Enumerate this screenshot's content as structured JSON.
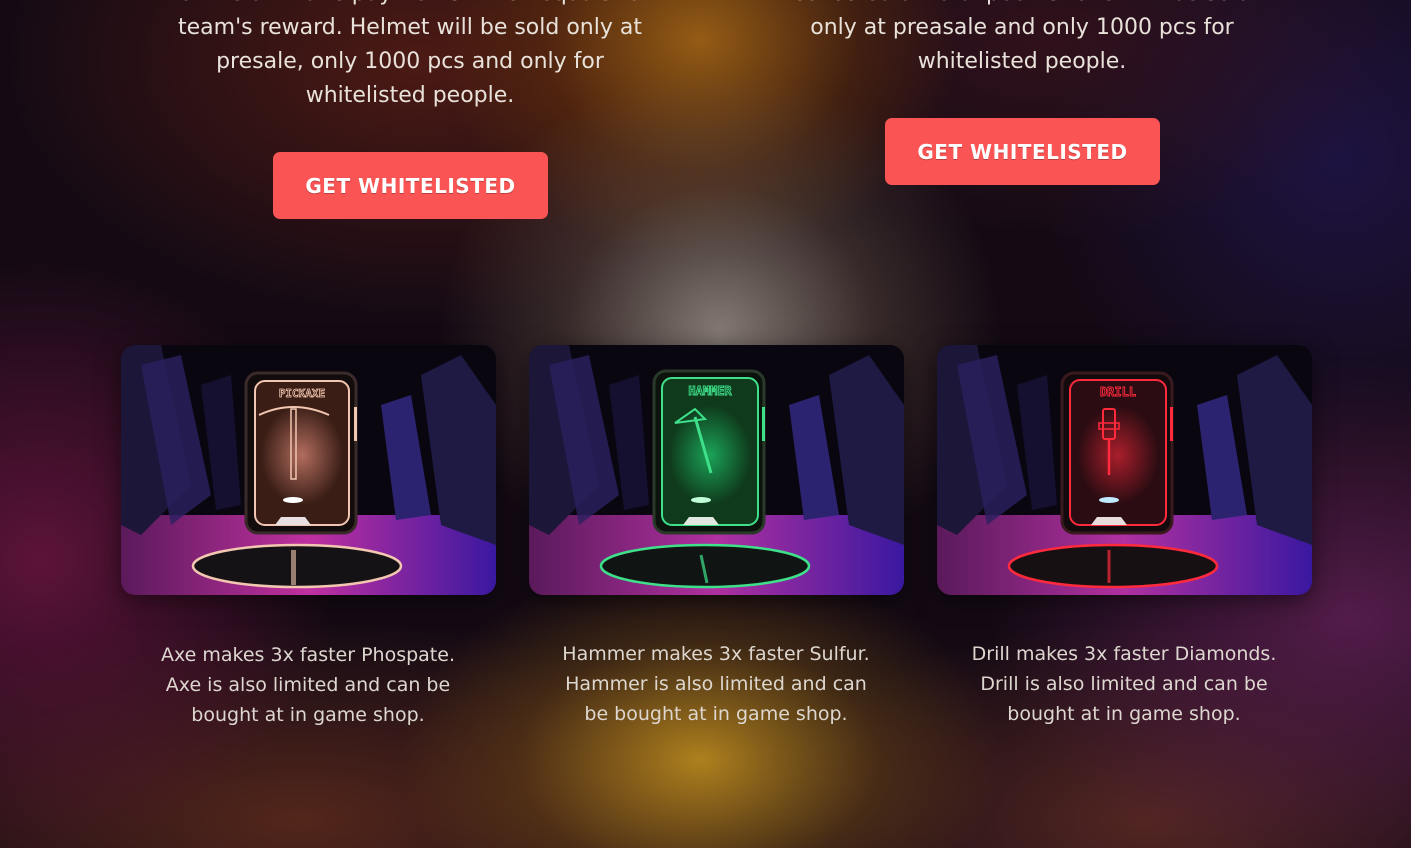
{
  "promo": {
    "left": {
      "text_lines": [
        "of the all matic payments which equals to",
        "team's reward. Helmet will be sold only at",
        "presale, only 1000 pcs and only for",
        "whitelisted people."
      ],
      "button_label": "GET WHITELISTED"
    },
    "right": {
      "text_lines": [
        "collected at total pool. Shovel will be sold",
        "only at preasale and only 1000 pcs for",
        "whitelisted people."
      ],
      "button_label": "GET WHITELISTED"
    }
  },
  "tools": [
    {
      "sign": "PICKAXE",
      "neon_color": "#f2c6b0",
      "description_lines": [
        "Axe makes 3x faster Phospate.",
        "Axe is also limited and can be",
        "bought at in game shop."
      ]
    },
    {
      "sign": "HAMMER",
      "neon_color": "#3ee08a",
      "description_lines": [
        "Hammer makes 3x faster Sulfur.",
        "Hammer is also limited and can",
        "be bought at in game shop."
      ]
    },
    {
      "sign": "DRILL",
      "neon_color": "#ff2a3c",
      "description_lines": [
        "Drill makes 3x faster Diamonds.",
        "Drill is also limited and can be",
        "bought at in game shop."
      ]
    }
  ],
  "colors": {
    "button": "#fb5454",
    "text": "#e8e2da"
  }
}
